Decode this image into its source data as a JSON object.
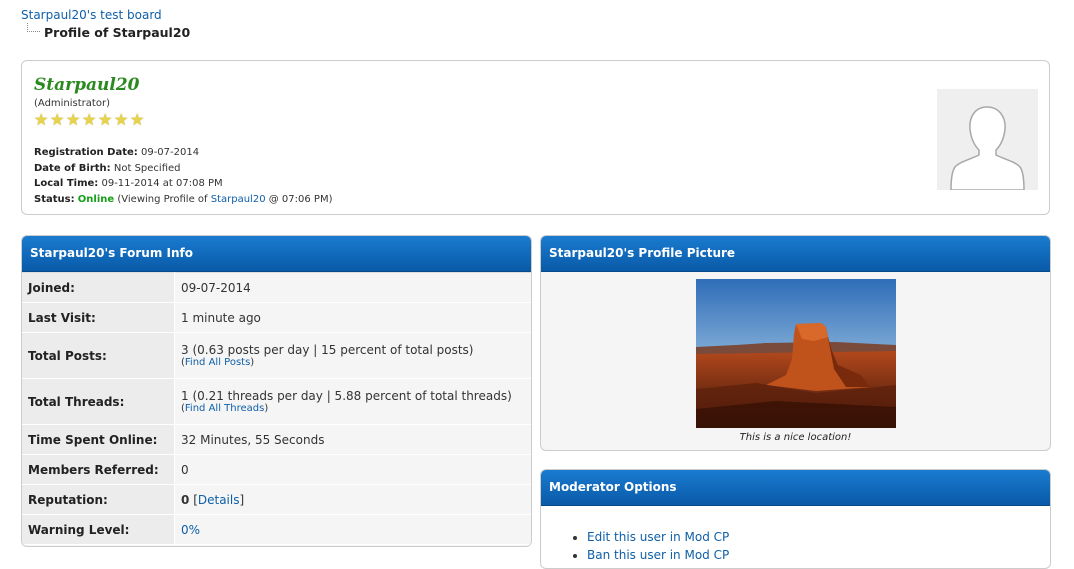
{
  "breadcrumb": {
    "root": "Starpaul20's test board",
    "current": "Profile of Starpaul20"
  },
  "profile": {
    "username": "Starpaul20",
    "usertitle": "(Administrator)",
    "stars_count": 7,
    "reg_label": "Registration Date:",
    "reg_value": "09-07-2014",
    "dob_label": "Date of Birth:",
    "dob_value": "Not Specified",
    "localtime_label": "Local Time:",
    "localtime_value": "09-11-2014 at 07:08 PM",
    "status_label": "Status:",
    "status_value": "Online",
    "viewing_prefix": "(Viewing Profile of",
    "viewing_link": "Starpaul20",
    "viewing_suffix": "@ 07:06 PM)"
  },
  "forum_info": {
    "title": "Starpaul20's Forum Info",
    "rows": [
      {
        "label": "Joined:",
        "value": "09-07-2014"
      },
      {
        "label": "Last Visit:",
        "value": "1 minute ago"
      },
      {
        "label": "Total Posts:",
        "value": "3 (0.63 posts per day | 15 percent of total posts)",
        "sub_open": "(",
        "sub_link": "Find All Posts",
        "sub_close": ")"
      },
      {
        "label": "Total Threads:",
        "value": "1 (0.21 threads per day | 5.88 percent of total threads)",
        "sub_open": "(",
        "sub_link": "Find All Threads",
        "sub_close": ")"
      },
      {
        "label": "Time Spent Online:",
        "value": "32 Minutes, 55 Seconds"
      },
      {
        "label": "Members Referred:",
        "value": "0"
      },
      {
        "label": "Reputation:",
        "value": "0",
        "open": "[",
        "link": "Details",
        "close": "]"
      },
      {
        "label": "Warning Level:",
        "link": "0%"
      }
    ]
  },
  "profile_picture": {
    "title": "Starpaul20's Profile Picture",
    "caption": "This is a nice location!"
  },
  "moderator": {
    "title": "Moderator Options",
    "items": [
      "Edit this user in Mod CP",
      "Ban this user in Mod CP"
    ]
  },
  "colors": {
    "header_blue": "#0a5aa8",
    "username_green": "#2a8a1f",
    "link_blue": "#0f5fa8",
    "online_green": "#15a018"
  }
}
